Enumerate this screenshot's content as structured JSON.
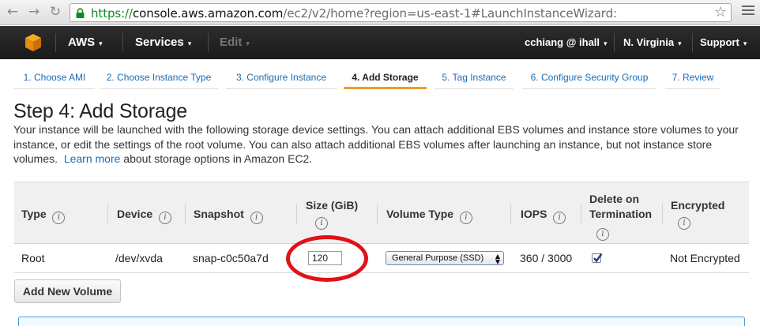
{
  "browser": {
    "url_scheme": "https://",
    "url_host": "console.aws.amazon.com",
    "url_path": "/ec2/v2/home?region=us-east-1#LaunchInstanceWizard:",
    "back_icon": "←",
    "forward_icon": "→",
    "reload_icon": "↻",
    "star_icon": "☆"
  },
  "aws_nav": {
    "brand": "AWS",
    "services": "Services",
    "edit": "Edit",
    "user": "cchiang @ ihall",
    "region": "N. Virginia",
    "support": "Support",
    "caret": "▾"
  },
  "wizard": {
    "steps": [
      {
        "label": "1. Choose AMI"
      },
      {
        "label": "2. Choose Instance Type"
      },
      {
        "label": "3. Configure Instance"
      },
      {
        "label": "4. Add Storage"
      },
      {
        "label": "5. Tag Instance"
      },
      {
        "label": "6. Configure Security Group"
      },
      {
        "label": "7. Review"
      }
    ],
    "active_step": 4
  },
  "page": {
    "title": "Step 4: Add Storage",
    "intro_text": "Your instance will be launched with the following storage device settings. You can attach additional EBS volumes and instance store volumes to your instance, or edit the settings of the root volume. You can also attach additional EBS volumes after launching an instance, but not instance store volumes.",
    "learn_more": "Learn more",
    "intro_suffix": "about storage options in Amazon EC2."
  },
  "storage_table": {
    "info_glyph": "i",
    "columns": {
      "type": "Type",
      "device": "Device",
      "snapshot": "Snapshot",
      "size": "Size (GiB)",
      "volume_type": "Volume Type",
      "iops": "IOPS",
      "delete_on_termination_1": "Delete on",
      "delete_on_termination_2": "Termination",
      "encrypted": "Encrypted"
    },
    "rows": [
      {
        "type": "Root",
        "device": "/dev/xvda",
        "snapshot": "snap-c0c50a7d",
        "size": "120",
        "volume_type": "General Purpose (SSD)",
        "iops": "360 / 3000",
        "delete_on_termination": true,
        "encrypted": "Not Encrypted"
      }
    ]
  },
  "actions": {
    "add_new_volume": "Add New Volume"
  },
  "colors": {
    "aws_nav_bg": "#232323",
    "link": "#1a6bb5",
    "active_tab_underline": "#f09a2a",
    "annotation_circle": "#e2101a"
  }
}
